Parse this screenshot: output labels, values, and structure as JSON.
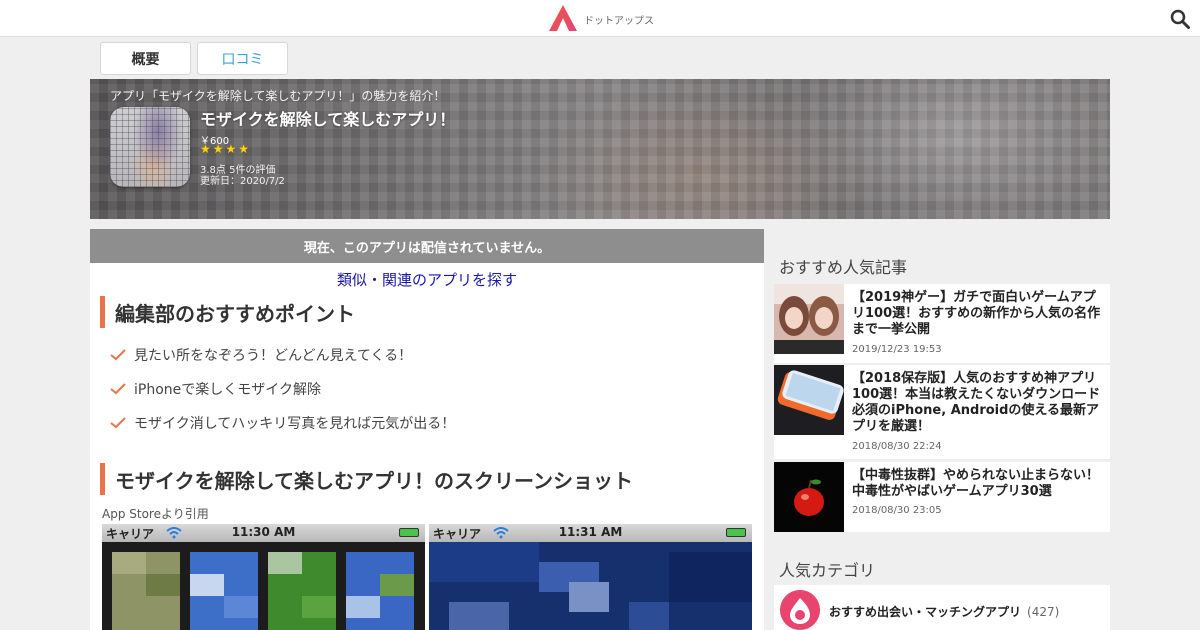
{
  "header": {
    "logo_text": "ドットアップス"
  },
  "tabs": [
    {
      "label": "概要"
    },
    {
      "label": "口コミ"
    }
  ],
  "hero": {
    "caption": "アプリ「モザイクを解除して楽しむアプリ！」の魅力を紹介！",
    "title": "モザイクを解除して楽しむアプリ！",
    "price": "￥600",
    "stars": "★★★★",
    "rating_text": "3.8点 5件の評価",
    "updated": "更新日：2020/7/2"
  },
  "main": {
    "notice": "現在、このアプリは配信されていません。",
    "similar_link": "類似・関連のアプリを探す",
    "points_heading": "編集部のおすすめポイント",
    "points": [
      "見たい所をなぞろう！どんどん見えてくる！",
      "iPhoneで楽しくモザイク解除",
      "モザイク消してハッキリ写真を見れば元気が出る！"
    ],
    "screenshots_heading": "モザイクを解除して楽しむアプリ！のスクリーンショット",
    "cite": "App Storeより引用",
    "screenshots": [
      {
        "carrier": "キャリア",
        "time": "11:30 AM"
      },
      {
        "carrier": "キャリア",
        "time": "11:31 AM"
      }
    ]
  },
  "sidebar": {
    "articles_title": "おすすめ人気記事",
    "articles": [
      {
        "title": "【2019神ゲー】ガチで面白いゲームアプリ100選！おすすめの新作から人気の名作まで一挙公開",
        "date": "2019/12/23 19:53"
      },
      {
        "title": "【2018保存版】人気のおすすめ神アプリ100選！本当は教えたくないダウンロード必須のiPhone, Androidの使える最新アプリを厳選！",
        "date": "2018/08/30 22:24"
      },
      {
        "title": "【中毒性抜群】やめられない止まらない！中毒性がやばいゲームアプリ30選",
        "date": "2018/08/30 23:05"
      }
    ],
    "categories_title": "人気カテゴリ",
    "categories": [
      {
        "label": "おすすめ出会い・マッチングアプリ",
        "count": "(427)"
      }
    ]
  },
  "colors": {
    "accent": "#e9734a",
    "link": "#1a1aa6",
    "tab_active_text": "#3aa0d8",
    "notice_bg": "#8e8e8e",
    "star": "#ffd200",
    "category_icon": "#e8446d"
  }
}
